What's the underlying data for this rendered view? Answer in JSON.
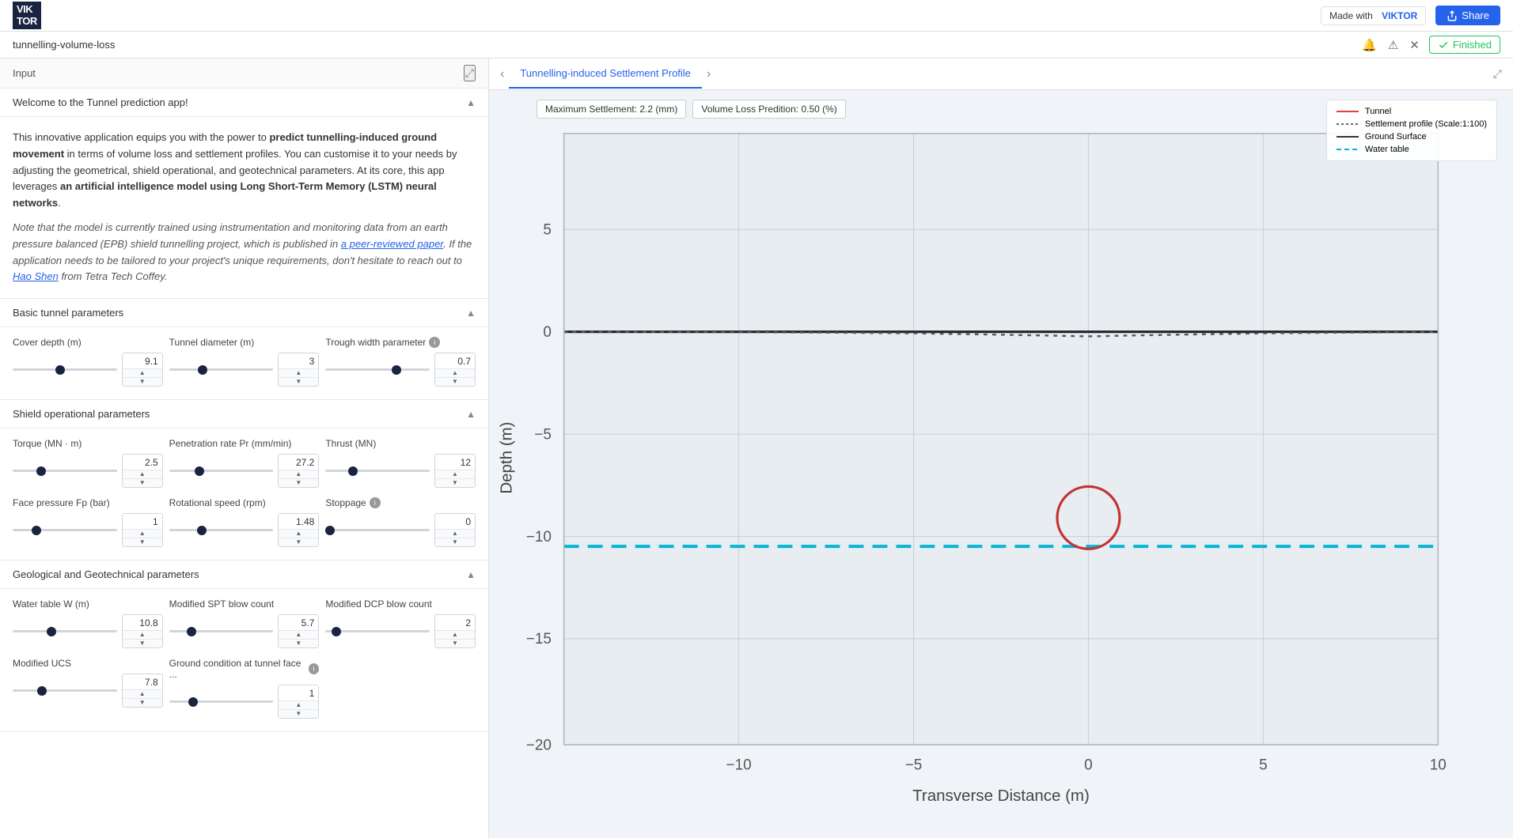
{
  "topNav": {
    "logoLine1": "VIK",
    "logoLine2": "TOR",
    "madeWith": "Made with",
    "viktorLink": "VIKTOR",
    "shareLabel": "Share"
  },
  "breadcrumb": {
    "appName": "tunnelling-volume-loss",
    "finishedLabel": "Finished"
  },
  "leftPanel": {
    "inputLabel": "Input",
    "welcome": {
      "sectionTitle": "Welcome to the Tunnel prediction app!",
      "para1a": "This innovative application equips you with the power to ",
      "para1b": "predict tunnelling-induced ground movement",
      "para1c": " in terms of volume loss and settlement profiles. You can customise it to your needs by adjusting the geometrical, shield operational, and geotechnical parameters. At its core, this app leverages ",
      "para1d": "an artificial intelligence model using Long Short-Term Memory (LSTM) neural networks",
      "para1e": ".",
      "para2a": "Note that the model is currently trained using instrumentation and monitoring data from an earth pressure balanced (EPB) shield tunnelling project, which is published in ",
      "para2b": "a peer-reviewed paper",
      "para2c": ". If the application needs to be tailored to your project's unique requirements, don't hesitate to reach out to ",
      "para2d": "Hao Shen",
      "para2e": " from Tetra Tech Coffey."
    },
    "basicTunnel": {
      "sectionTitle": "Basic tunnel parameters",
      "params": [
        {
          "label": "Cover depth (m)",
          "value": "9.1",
          "min": 0,
          "max": 20,
          "step": 0.1,
          "pct": 45,
          "hasInfo": false
        },
        {
          "label": "Tunnel diameter (m)",
          "value": "3",
          "min": 0,
          "max": 10,
          "step": 0.1,
          "pct": 30,
          "hasInfo": false
        },
        {
          "label": "Trough width parameter",
          "value": "0.7",
          "min": 0,
          "max": 1,
          "step": 0.1,
          "pct": 70,
          "hasInfo": true
        }
      ]
    },
    "shieldOp": {
      "sectionTitle": "Shield operational parameters",
      "params": [
        {
          "label": "Torque (MN · m)",
          "value": "2.5",
          "min": 0,
          "max": 10,
          "step": 0.1,
          "pct": 25,
          "hasInfo": false
        },
        {
          "label": "Penetration rate Pr (mm/min)",
          "value": "27.2",
          "min": 0,
          "max": 100,
          "step": 0.1,
          "pct": 27,
          "hasInfo": false
        },
        {
          "label": "Thrust (MN)",
          "value": "12",
          "min": 0,
          "max": 50,
          "step": 1,
          "pct": 24,
          "hasInfo": false
        },
        {
          "label": "Face pressure Fp (bar)",
          "value": "1",
          "min": 0,
          "max": 5,
          "step": 0.1,
          "pct": 20,
          "hasInfo": false
        },
        {
          "label": "Rotational speed (rpm)",
          "value": "1.48",
          "min": 0,
          "max": 5,
          "step": 0.01,
          "pct": 30,
          "hasInfo": false
        },
        {
          "label": "Stoppage",
          "value": "0",
          "min": 0,
          "max": 5,
          "step": 1,
          "pct": 0,
          "hasInfo": true
        }
      ]
    },
    "geotech": {
      "sectionTitle": "Geological and Geotechnical parameters",
      "params": [
        {
          "label": "Water table W (m)",
          "value": "10.8",
          "min": 0,
          "max": 30,
          "step": 0.1,
          "pct": 36,
          "hasInfo": false
        },
        {
          "label": "Modified SPT blow count",
          "value": "5.7",
          "min": 0,
          "max": 30,
          "step": 0.1,
          "pct": 19,
          "hasInfo": false
        },
        {
          "label": "Modified DCP blow count",
          "value": "2",
          "min": 0,
          "max": 30,
          "step": 1,
          "pct": 7,
          "hasInfo": false
        },
        {
          "label": "Modified UCS",
          "value": "7.8",
          "min": 0,
          "max": 30,
          "step": 0.1,
          "pct": 26,
          "hasInfo": false
        },
        {
          "label": "Ground condition at tunnel face ...",
          "value": "1",
          "min": 0,
          "max": 5,
          "step": 1,
          "pct": 20,
          "hasInfo": true
        }
      ]
    }
  },
  "rightPanel": {
    "tabs": [
      {
        "label": "Tunnelling-induced Settlement Profile",
        "active": true
      }
    ],
    "chart": {
      "maxSettlementLabel": "Maximum Settlement: 2.2 (mm)",
      "volumeLossLabel": "Volume Loss Predition: 0.50 (%)",
      "legend": {
        "tunnel": "Tunnel",
        "settlementProfile": "Settlement profile (Scale:1:100)",
        "groundSurface": "Ground Surface",
        "waterTable": "Water table"
      },
      "xAxisLabel": "Transverse Distance (m)",
      "yAxisLabel": "Depth (m)",
      "xTicks": [
        "-10",
        "-5",
        "0",
        "5",
        "10"
      ],
      "yTicks": [
        "5",
        "0",
        "-5",
        "-10",
        "-15",
        "-20"
      ],
      "tunnelCenterX": 0,
      "tunnelCenterY": -9.1,
      "tunnelRadius": 1.5,
      "waterTableDepth": -10.5,
      "groundSurfaceY": 0
    }
  }
}
